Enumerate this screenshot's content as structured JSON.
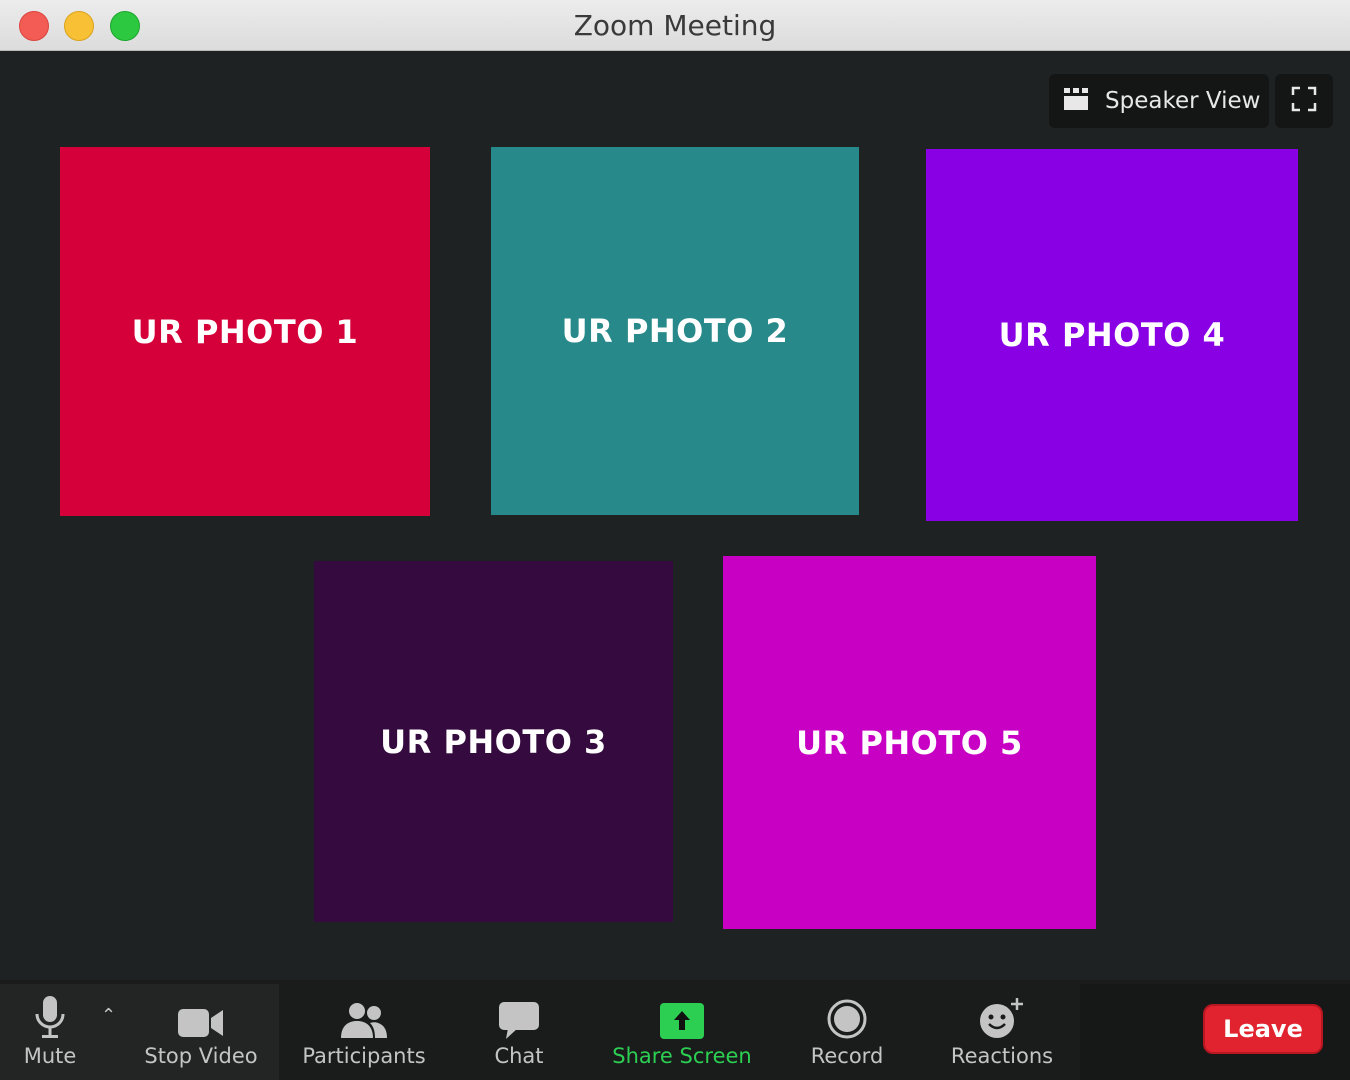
{
  "window": {
    "title": "Zoom Meeting"
  },
  "view_controls": {
    "speaker_view_label": "Speaker View"
  },
  "tiles": [
    {
      "label": "UR PHOTO 1",
      "color": "#d5003a"
    },
    {
      "label": "UR PHOTO 2",
      "color": "#28898a"
    },
    {
      "label": "UR PHOTO 4",
      "color": "#8800e3"
    },
    {
      "label": "UR PHOTO 3",
      "color": "#350b3f"
    },
    {
      "label": "UR PHOTO 5",
      "color": "#c800c3"
    }
  ],
  "toolbar": {
    "mute_label": "Mute",
    "stop_video_label": "Stop Video",
    "participants_label": "Participants",
    "chat_label": "Chat",
    "share_screen_label": "Share Screen",
    "record_label": "Record",
    "reactions_label": "Reactions",
    "leave_label": "Leave"
  },
  "colors": {
    "background": "#1f2222",
    "share_accent": "#2ccf52",
    "leave": "#e0232e"
  }
}
